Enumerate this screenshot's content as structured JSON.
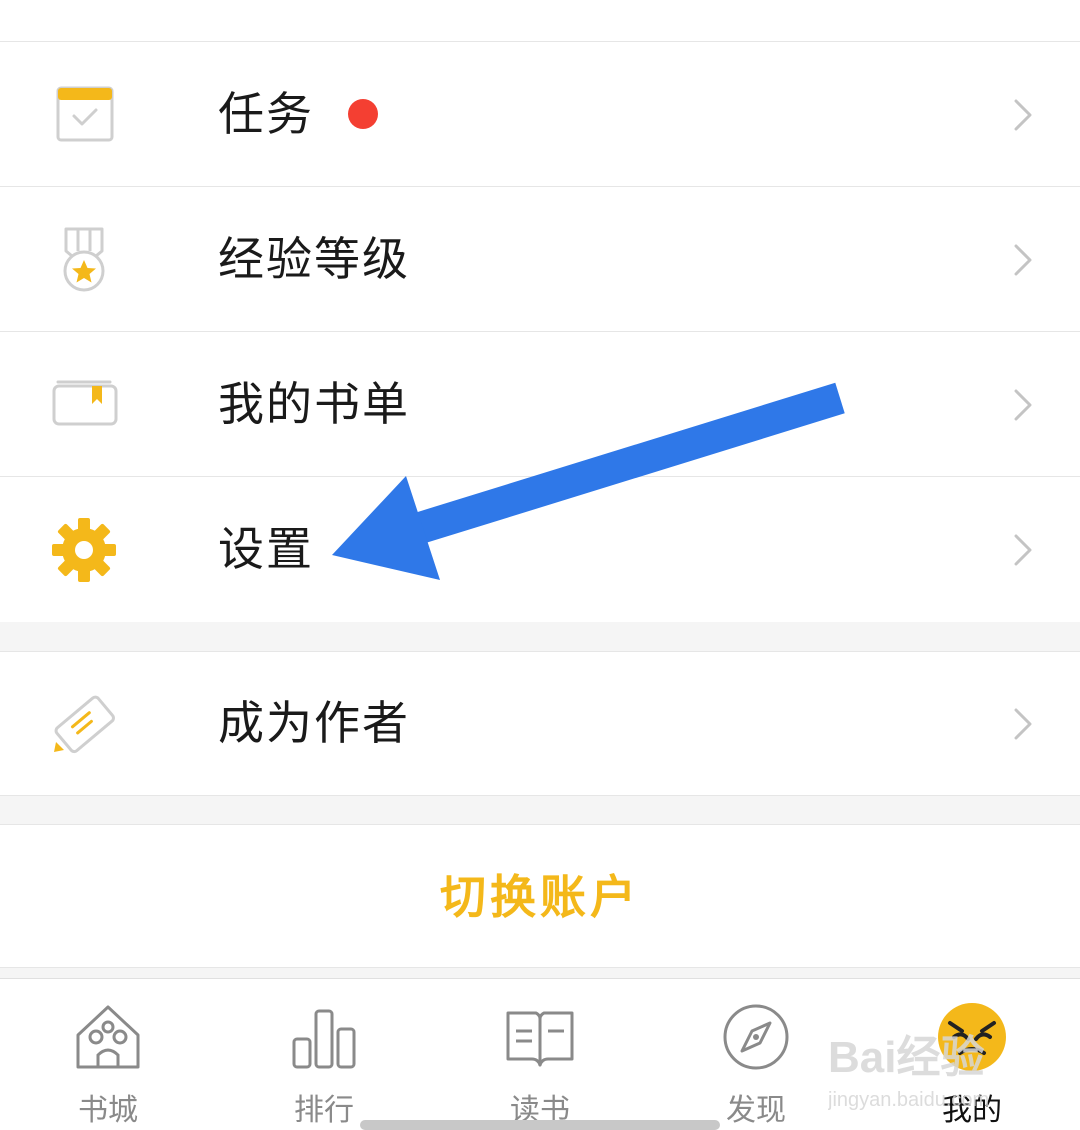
{
  "menu": {
    "items": [
      {
        "label": "任务",
        "icon": "calendar-check-icon",
        "has_badge": true
      },
      {
        "label": "经验等级",
        "icon": "medal-icon",
        "has_badge": false
      },
      {
        "label": "我的书单",
        "icon": "booklist-icon",
        "has_badge": false
      },
      {
        "label": "设置",
        "icon": "gear-icon",
        "has_badge": false
      }
    ],
    "author": {
      "label": "成为作者",
      "icon": "pencil-icon"
    }
  },
  "switch_account": {
    "label": "切换账户"
  },
  "tabbar": {
    "tabs": [
      {
        "label": "书城",
        "icon": "house-icon",
        "active": false
      },
      {
        "label": "排行",
        "icon": "bar-chart-icon",
        "active": false
      },
      {
        "label": "读书",
        "icon": "open-book-icon",
        "active": false
      },
      {
        "label": "发现",
        "icon": "compass-icon",
        "active": false
      },
      {
        "label": "我的",
        "icon": "avatar-icon",
        "active": true
      }
    ]
  },
  "watermark": {
    "text": "Bai经验",
    "subtext": "jingyan.baidu.com"
  },
  "colors": {
    "accent": "#f4b81a",
    "badge": "#f43f32",
    "annotation_arrow": "#2f78e8",
    "text_primary": "#1a1a1a",
    "text_muted": "#8a8a8a",
    "divider": "#e6e6e6",
    "background": "#f5f5f5"
  }
}
